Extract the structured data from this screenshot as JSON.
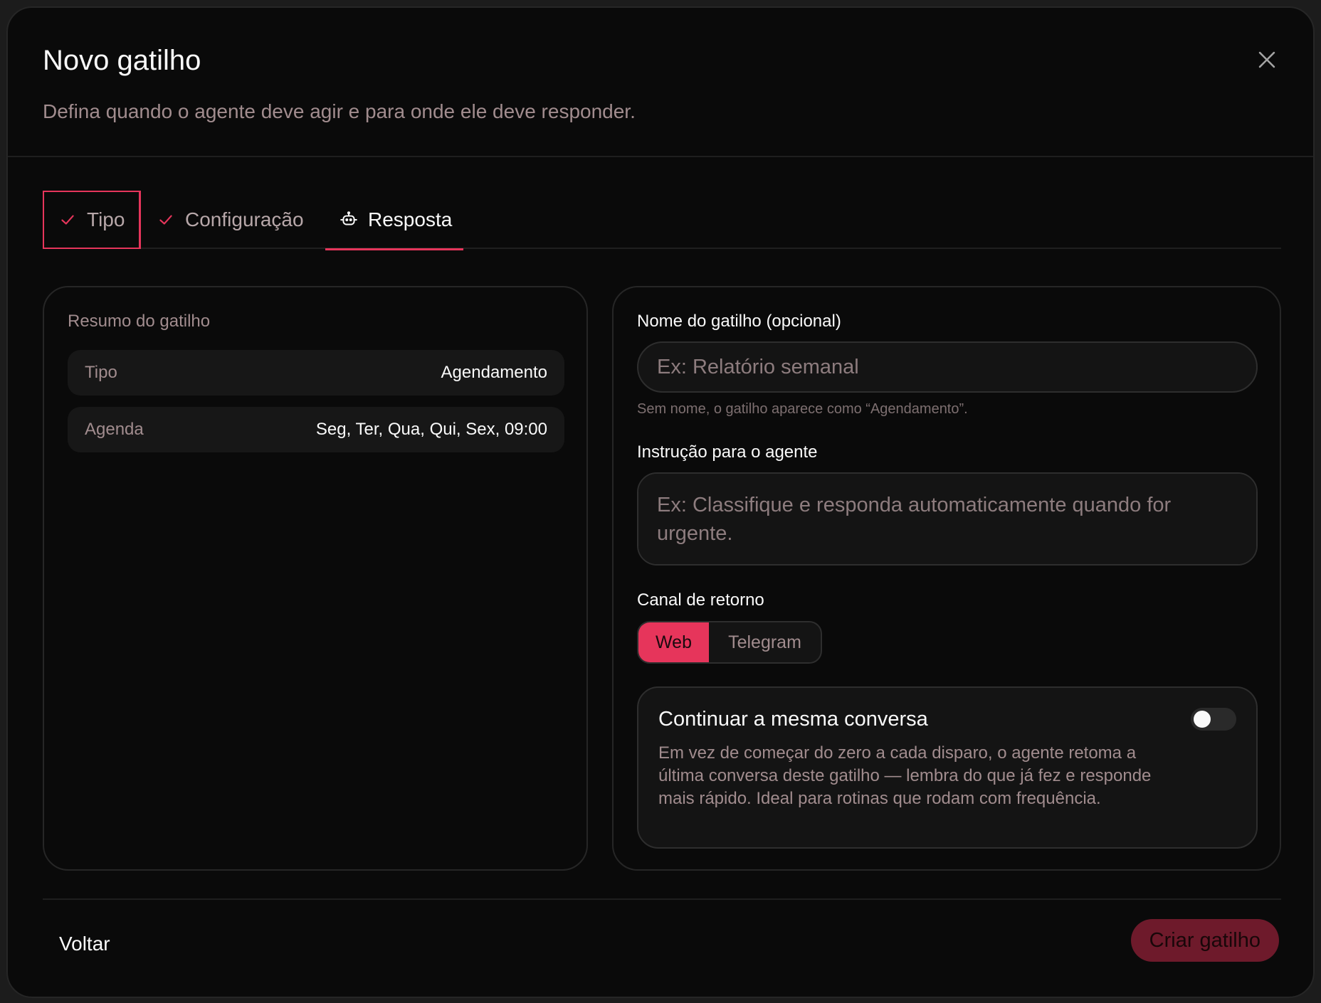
{
  "dialog": {
    "title": "Novo gatilho",
    "subtitle": "Defina quando o agente deve agir e para onde ele deve responder."
  },
  "tabs": [
    {
      "label": "Tipo",
      "icon": "check-icon",
      "state": "completed"
    },
    {
      "label": "Configuração",
      "icon": "check-icon",
      "state": "completed"
    },
    {
      "label": "Resposta",
      "icon": "robot-icon",
      "state": "active"
    }
  ],
  "summary": {
    "title": "Resumo do gatilho",
    "rows": [
      {
        "key": "Tipo",
        "value": "Agendamento"
      },
      {
        "key": "Agenda",
        "value": "Seg, Ter, Qua, Qui, Sex, 09:00"
      }
    ]
  },
  "form": {
    "name_label": "Nome do gatilho (opcional)",
    "name_value": "",
    "name_placeholder": "Ex: Relatório semanal",
    "name_hint": "Sem nome, o gatilho aparece como “Agendamento”.",
    "instruction_label": "Instrução para o agente",
    "instruction_value": "",
    "instruction_placeholder": "Ex: Classifique e responda automaticamente quando for urgente.",
    "channel_label": "Canal de retorno",
    "channels": [
      {
        "label": "Web",
        "selected": true
      },
      {
        "label": "Telegram",
        "selected": false
      }
    ],
    "continue_title": "Continuar a mesma conversa",
    "continue_desc": "Em vez de começar do zero a cada disparo, o agente retoma a última conversa deste gatilho — lembra do que já fez e responde mais rápido. Ideal para rotinas que rodam com frequência.",
    "continue_enabled": false
  },
  "footer": {
    "back_label": "Voltar",
    "create_label": "Criar gatilho"
  },
  "colors": {
    "accent": "#e6355b",
    "background": "#0a0a0a",
    "muted_text": "#a18c8e"
  }
}
